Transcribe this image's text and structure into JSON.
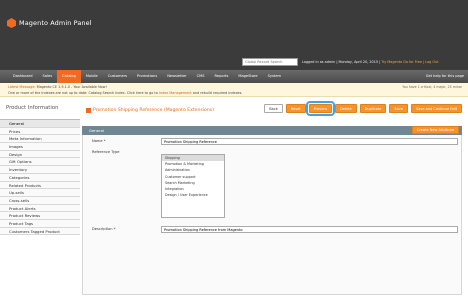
{
  "header": {
    "logo_text": "Magento Admin Panel",
    "search_placeholder": "Global Record Search",
    "user_info": "Logged in as admin | Monday, April 20, 2015 |",
    "links": "Try Magento Go for Free | Log Out"
  },
  "nav": {
    "items": [
      "Dashboard",
      "Sales",
      "Catalog",
      "Mobile",
      "Customers",
      "Promotions",
      "Newsletter",
      "CMS",
      "Reports",
      "MageStore",
      "System"
    ],
    "active_index": 2,
    "help": "Get help for this page"
  },
  "notices": {
    "line1_label": "Latest Message:",
    "line1_text": "Magento CE 1.9.1.0 - Your Available Now!",
    "line2_prefix": "One or more of the Indexes are not up to date: Catalog Search Index. Click here to go to",
    "line2_link": "Index Management",
    "line2_suffix": "and rebuild required indexes.",
    "right_text": "You have 1 critical, 4 major, 25 minor"
  },
  "sidebar": {
    "title": "Product Information",
    "items": [
      "General",
      "Prices",
      "Meta Information",
      "Images",
      "Design",
      "Gift Options",
      "Inventory",
      "Categories",
      "Related Products",
      "Up-sells",
      "Cross-sells",
      "Product Alerts",
      "Product Reviews",
      "Product Tags",
      "Customers Tagged Product"
    ],
    "active_index": 0
  },
  "title": {
    "text": "Promotion Shipping Reference (Magento Extensions)"
  },
  "toolbar": {
    "back": "Back",
    "reset": "Reset",
    "preview": "Preview",
    "delete": "Delete",
    "duplicate": "Duplicate",
    "save": "Save",
    "save_continue": "Save and Continue Edit"
  },
  "panel": {
    "title": "General",
    "new_attribute": "Create New Attribute"
  },
  "form": {
    "name_label": "Name *",
    "name_value": "Promotion Shipping Reference",
    "ref_label": "Reference Type",
    "ref_options": [
      "Shipping",
      "Promotion & Marketing",
      "Administration",
      "Customer support",
      "Search Marketing",
      "Integration",
      "Design / User Experience"
    ],
    "ref_selected_index": 0,
    "desc_label": "Description *",
    "desc_value": "Promotion Shipping Reference from Magento"
  }
}
